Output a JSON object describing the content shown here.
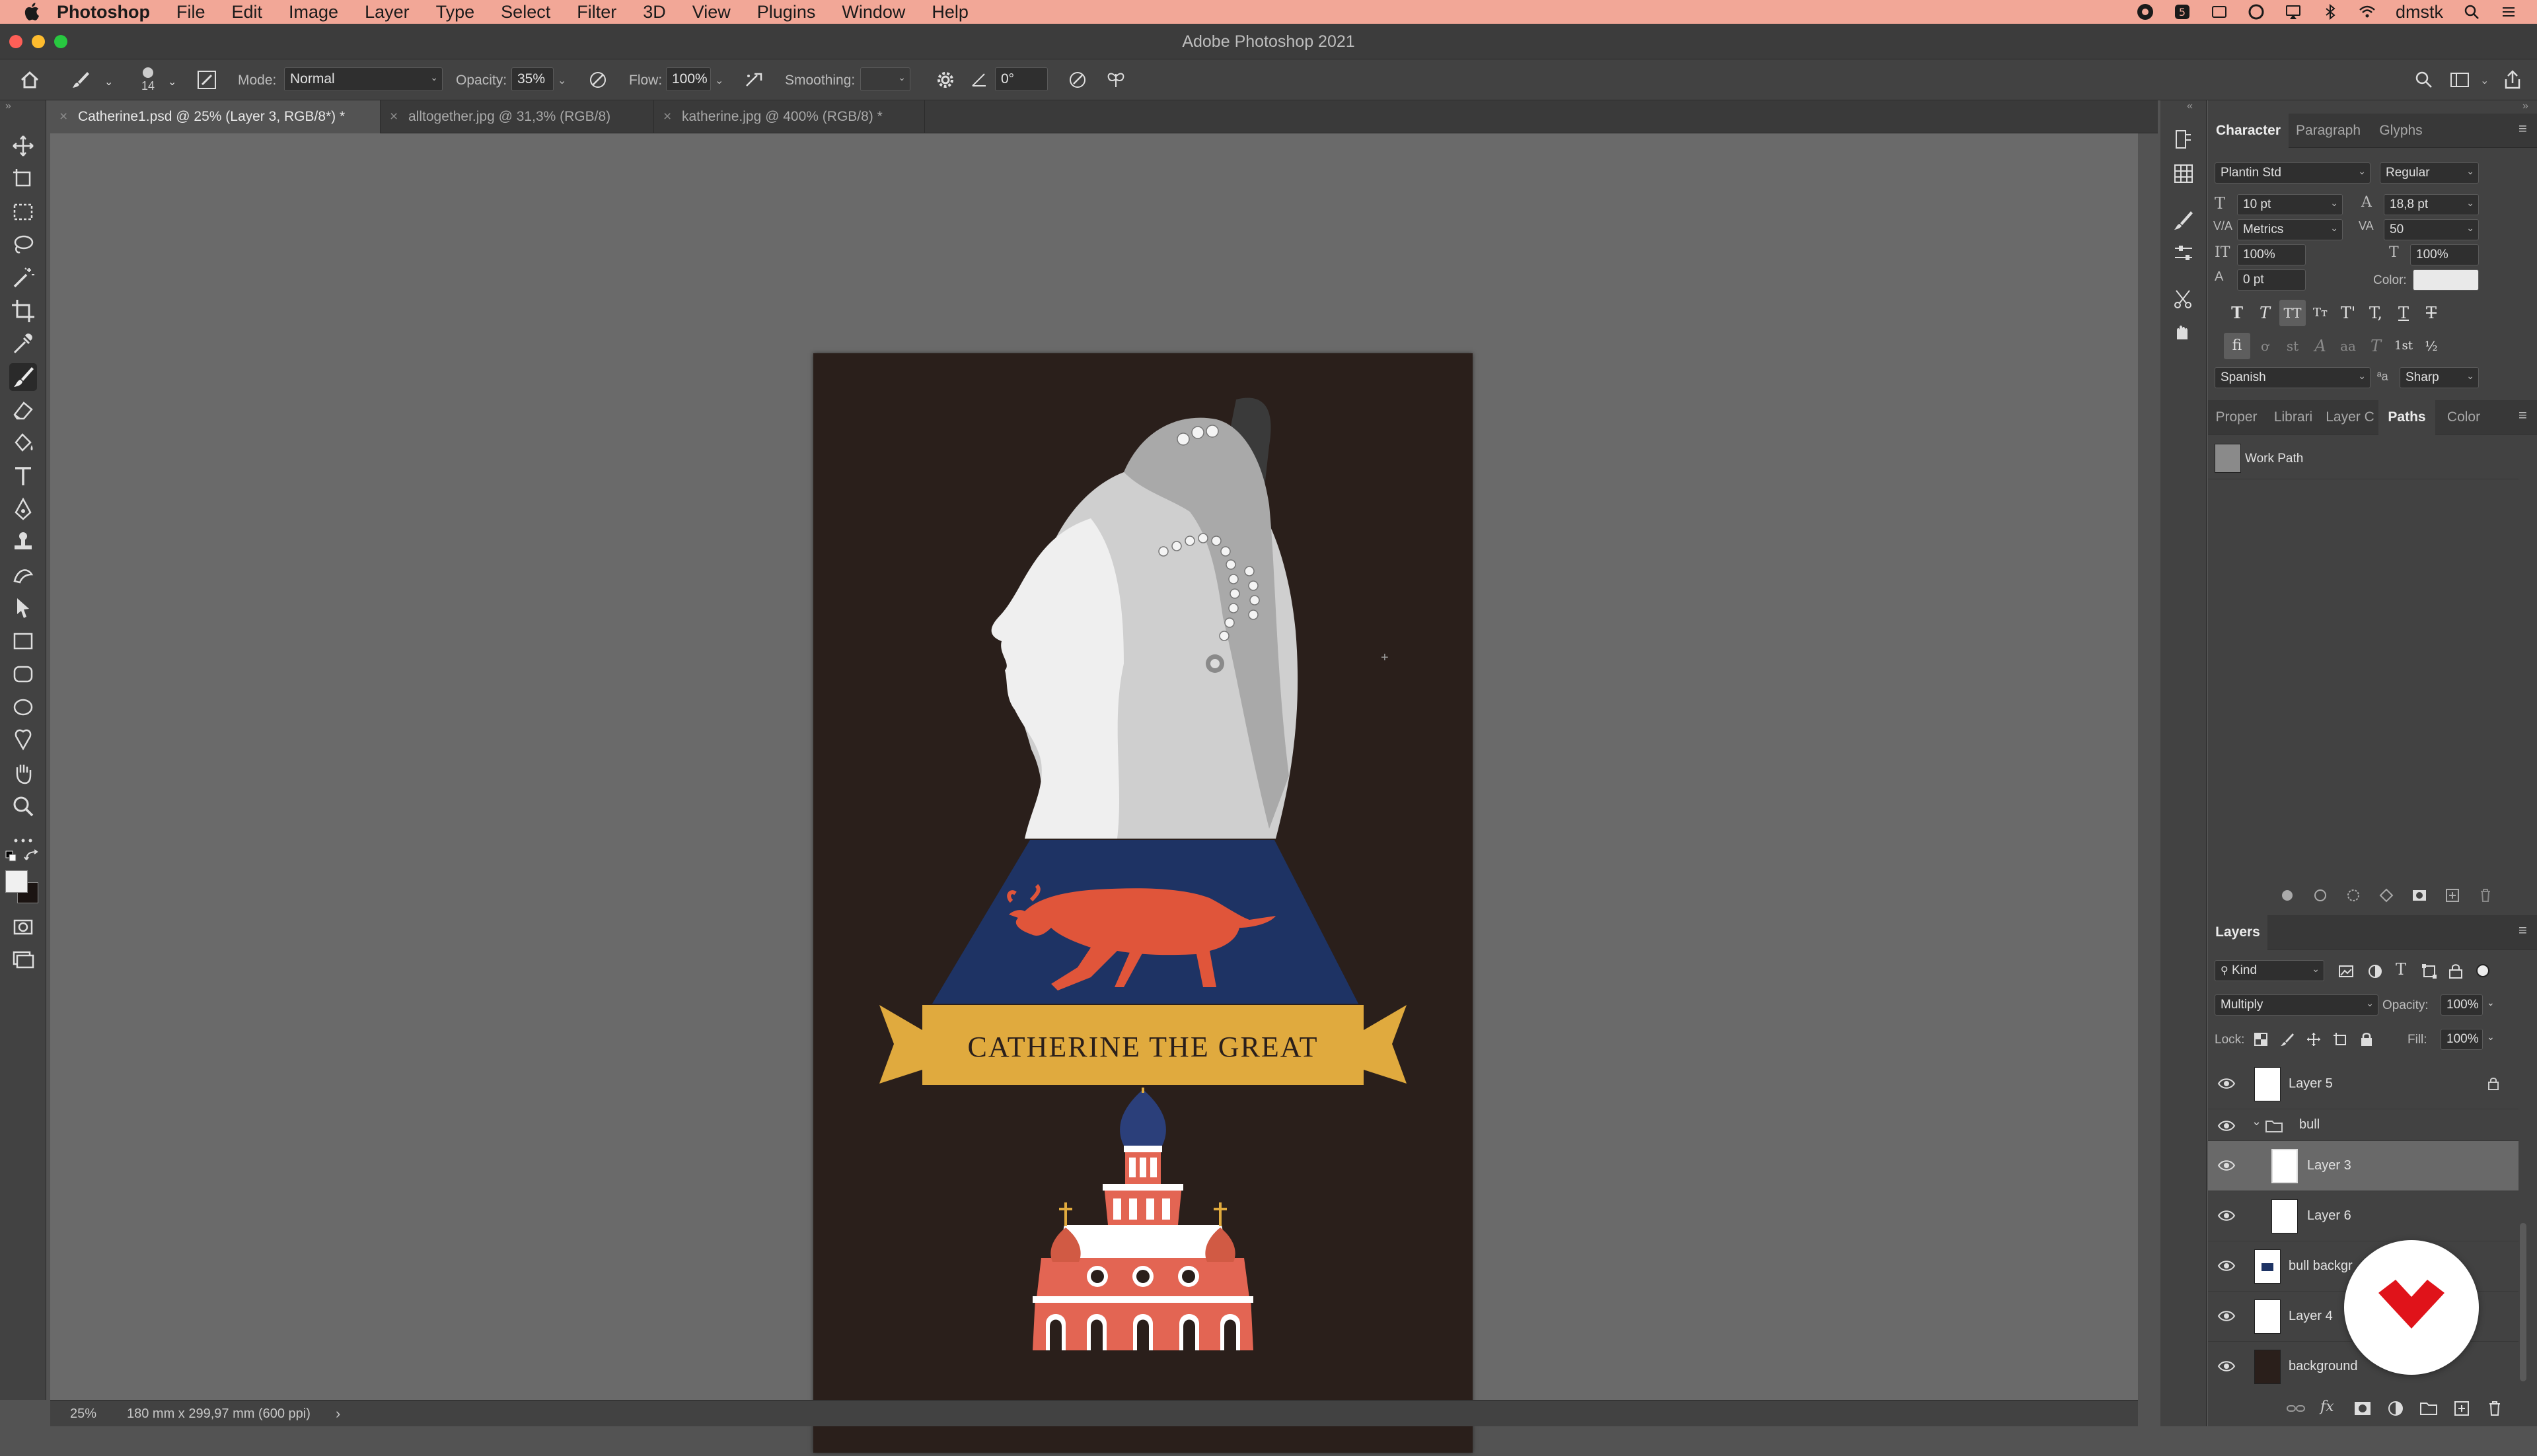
{
  "menubar": {
    "app_name": "Photoshop",
    "items": [
      "File",
      "Edit",
      "Image",
      "Layer",
      "Type",
      "Select",
      "Filter",
      "3D",
      "View",
      "Plugins",
      "Window",
      "Help"
    ],
    "user": "dmstk"
  },
  "window": {
    "title": "Adobe Photoshop 2021"
  },
  "options": {
    "brush_size": "14",
    "mode_label": "Mode:",
    "mode_value": "Normal",
    "opacity_label": "Opacity:",
    "opacity_value": "35%",
    "flow_label": "Flow:",
    "flow_value": "100%",
    "smoothing_label": "Smoothing:",
    "smoothing_value": "",
    "angle_value": "0°"
  },
  "tabs": [
    {
      "label": "Catherine1.psd @ 25% (Layer 3, RGB/8*) *"
    },
    {
      "label": "alltogether.jpg @ 31,3% (RGB/8)"
    },
    {
      "label": "katherine.jpg @ 400% (RGB/8) *"
    }
  ],
  "poster": {
    "banner_text": "CATHERINE THE GREAT",
    "colors": {
      "background": "#2a1f1b",
      "navy": "#1e3364",
      "gold": "#e0aa3e",
      "bull": "#e0553a",
      "church": "#e36553"
    }
  },
  "status": {
    "zoom": "25%",
    "doc_info": "180 mm x 299,97 mm (600 ppi)"
  },
  "character": {
    "tabs": [
      "Character",
      "Paragraph",
      "Glyphs"
    ],
    "font_family": "Plantin Std",
    "font_style": "Regular",
    "size": "10 pt",
    "leading": "18,8 pt",
    "kerning": "Metrics",
    "tracking": "50",
    "vscale": "100%",
    "hscale": "100%",
    "baseline": "0 pt",
    "color_label": "Color:",
    "language": "Spanish",
    "aa_label": "a",
    "antialias": "Sharp"
  },
  "paths_panel": {
    "tabs": [
      "Proper",
      "Librari",
      "Layer C",
      "Paths",
      "Color"
    ],
    "items": [
      "Work Path"
    ]
  },
  "layers_panel": {
    "title": "Layers",
    "filter_kind": "Kind",
    "blend_mode": "Multiply",
    "opacity_label": "Opacity:",
    "opacity": "100%",
    "lock_label": "Lock:",
    "fill_label": "Fill:",
    "fill": "100%",
    "layers": [
      {
        "name": "Layer 5"
      },
      {
        "name": "bull"
      },
      {
        "name": "Layer 3"
      },
      {
        "name": "Layer 6"
      },
      {
        "name": "bull backgr"
      },
      {
        "name": "Layer 4"
      },
      {
        "name": "background"
      }
    ]
  }
}
